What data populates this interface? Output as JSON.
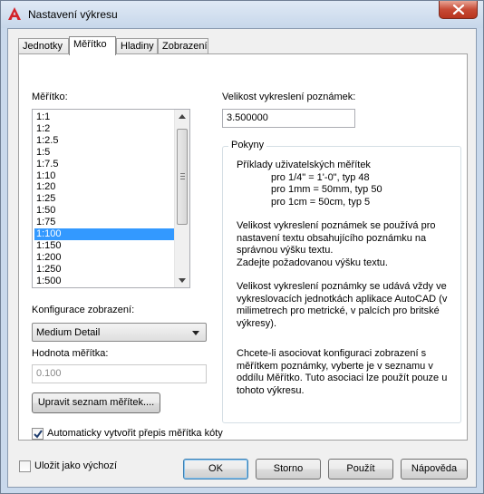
{
  "window": {
    "title": "Nastavení výkresu",
    "app_icon": "autocad-a-icon",
    "close_icon": "close-x-icon"
  },
  "tabs": [
    {
      "label": "Jednotky",
      "active": false
    },
    {
      "label": "Měřítko",
      "active": true
    },
    {
      "label": "Hladiny",
      "active": false
    },
    {
      "label": "Zobrazení",
      "active": false
    }
  ],
  "scale": {
    "label": "Měřítko:",
    "items": [
      "1:1",
      "1:2",
      "1:2.5",
      "1:5",
      "1:7.5",
      "1:10",
      "1:20",
      "1:25",
      "1:50",
      "1:75",
      "1:100",
      "1:150",
      "1:200",
      "1:250",
      "1:500"
    ],
    "selected": "1:100"
  },
  "display_config": {
    "label": "Konfigurace zobrazení:",
    "value": "Medium Detail"
  },
  "scale_value": {
    "label": "Hodnota měřítka:",
    "value": "0.100"
  },
  "edit_scales_button": "Upravit seznam měřítek....",
  "auto_override": {
    "label": "Automaticky vytvořit přepis měřítka kóty",
    "checked": true
  },
  "annotation_scale": {
    "label": "Velikost vykreslení poznámek:",
    "value": "3.500000"
  },
  "guidelines": {
    "title": "Pokyny",
    "examples_heading": "Příklady uživatelských měřítek",
    "examples": [
      "pro 1/4\" = 1'-0\", typ 48",
      "pro 1mm = 50mm, typ 50",
      "pro 1cm = 50cm, typ 5"
    ],
    "para1": [
      "Velikost vykreslení poznámek se používá pro",
      "nastavení textu obsahujícího poznámku na",
      "správnou výšku textu.",
      "Zadejte požadovanou výšku textu."
    ],
    "para2": [
      "Velikost vykreslení poznámky se udává vždy ve",
      "vykreslovacích jednotkách aplikace AutoCAD (v",
      "milimetrech pro metrické, v palcích pro britské",
      "výkresy)."
    ],
    "para3": [
      "Chcete-li asociovat konfiguraci zobrazení s",
      "měřítkem poznámky, vyberte je v seznamu v",
      "oddílu Měřítko. Tuto asociaci lze použít pouze u",
      "tohoto výkresu."
    ]
  },
  "save_default": {
    "label": "Uložit jako výchozí",
    "checked": false
  },
  "buttons": {
    "ok": "OK",
    "cancel": "Storno",
    "apply": "Použít",
    "help": "Nápověda"
  }
}
